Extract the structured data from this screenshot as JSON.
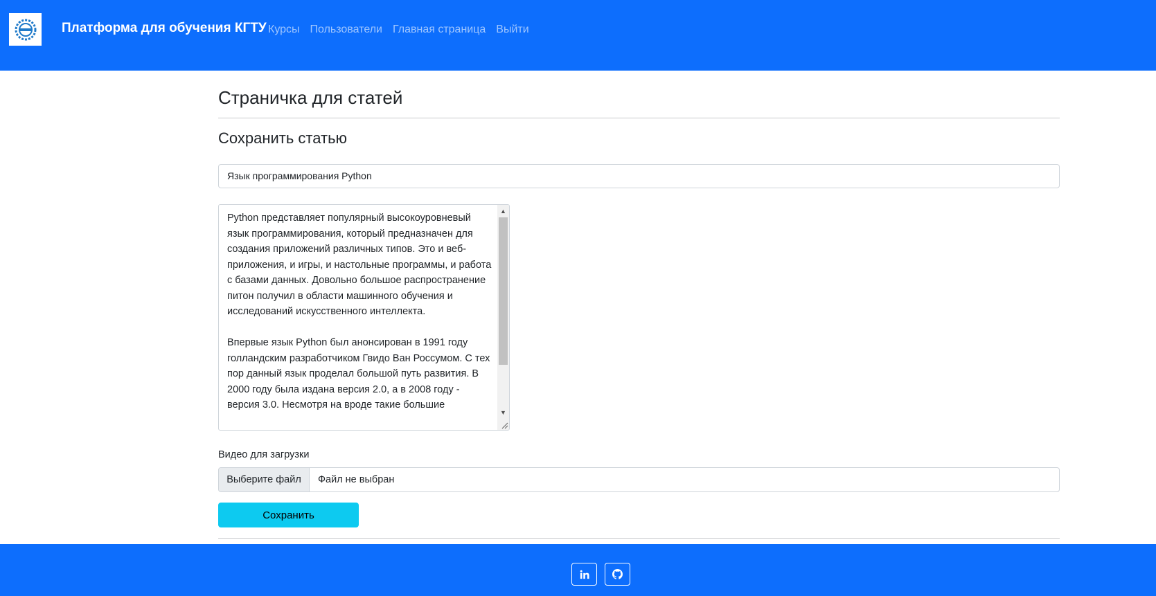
{
  "navbar": {
    "brand": "Платформа для обучения КГТУ",
    "logo_icon": "gear-logo-icon",
    "links": [
      {
        "label": "Курсы"
      },
      {
        "label": "Пользователи"
      },
      {
        "label": "Главная страница"
      },
      {
        "label": "Выйти"
      }
    ]
  },
  "main": {
    "page_title": "Страничка для статей",
    "section_title": "Сохранить статью",
    "title_input_value": "Язык программирования Python",
    "content_value": "Python представляет популярный высокоуровневый язык программирования, который предназначен для создания приложений различных типов. Это и веб-приложения, и игры, и настольные программы, и работа с базами данных. Довольно большое распространение питон получил в области машинного обучения и исследований искусственного интеллекта.\n\nВпервые язык Python был анонсирован в 1991 году голландским разработчиком Гвидо Ван Россумом. С тех пор данный язык проделал большой путь развития. В 2000 году была издана версия 2.0, а в 2008 году - версия 3.0. Несмотря на вроде такие большие",
    "video_label": "Видео для загрузки",
    "file_button_label": "Выберите файл",
    "file_status": "Файл не выбран",
    "save_label": "Сохранить"
  },
  "footer": {
    "social": [
      {
        "icon": "linkedin-icon"
      },
      {
        "icon": "github-icon"
      }
    ]
  },
  "colors": {
    "primary": "#0d6efd",
    "info": "#0dcaf0"
  }
}
